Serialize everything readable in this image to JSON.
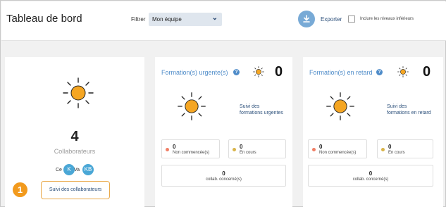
{
  "header": {
    "title": "Tableau de bord",
    "filter_label": "Filtrer",
    "filter_value": "Mon équipe",
    "export_label": "Exporter",
    "include_label": "Inclure les niveaux inférieurs"
  },
  "team_card": {
    "count": "4",
    "label": "Collaborateurs",
    "avatars": [
      {
        "initials": "Ce"
      },
      {
        "initials": "K"
      },
      {
        "initials": "Va"
      },
      {
        "initials": "KB"
      }
    ],
    "step_number": "1",
    "button_label": "Suivi des collaborateurs"
  },
  "urgent_card": {
    "title": "Formation(s) urgente(s)",
    "value": "0",
    "link_line1": "Suivi des",
    "link_line2": "formations urgentes",
    "not_started_value": "0",
    "not_started_label": "Non commencée(s)",
    "in_progress_value": "0",
    "in_progress_label": "En cours",
    "concerned_value": "0",
    "concerned_label": "collab. concerné(s)"
  },
  "late_card": {
    "title": "Formation(s) en retard",
    "value": "0",
    "link_line1": "Suivi des",
    "link_line2": "formations en retard",
    "not_started_value": "0",
    "not_started_label": "Non commencée(s)",
    "in_progress_value": "0",
    "in_progress_label": "En cours",
    "concerned_value": "0",
    "concerned_label": "collab. concerné(s)"
  },
  "colors": {
    "sun": "#f5a623",
    "not_started_dot": "#f07e65",
    "in_progress_dot": "#d9b44a",
    "accent_blue": "#4f8cc9",
    "step_orange": "#f29a1d"
  },
  "icons": {
    "export": "download-icon",
    "status": "sun-icon",
    "help": "help-icon",
    "dropdown": "chevron-down-icon"
  }
}
